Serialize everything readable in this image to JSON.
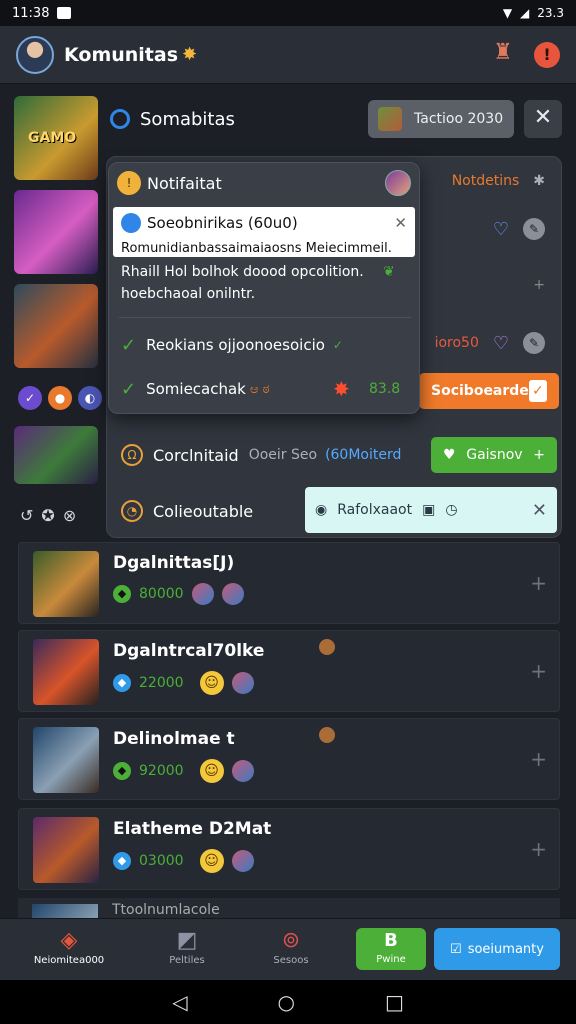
{
  "status_bar": {
    "time": "11:38",
    "right": "23.3"
  },
  "header": {
    "title": "Komunitas",
    "spark": "✸"
  },
  "sidebar": {
    "thumb_label": "GAMO"
  },
  "soma_bar": {
    "label": "Somabitas",
    "pill_text": "Tactioo 2030",
    "close": "✕"
  },
  "back_panel": {
    "row1_text": "Notdetins",
    "row4_text": "ioro50",
    "orange_button": "Sociboearde",
    "row5_name": "Corclnitaid",
    "row5_dim": "Ooeir Seo",
    "row5_blue": "(60Moiterd",
    "green_button": "Gaisnov",
    "row6_name": "Colieoutable",
    "cyan_text": "Rafolxaaot"
  },
  "popup": {
    "title": "Notifaitat",
    "card_title": "Soeobnirikas (60u0)",
    "card_line1": "Romunidianbassaimaiaosns Meiecimmeil.",
    "text_line1": "Rhaill Hol bolhok doood opcolition.",
    "text_line2": "hoebchaoal onilntr.",
    "row1": "Reokians ojjoonoesoicio",
    "row2": "Somiecachak",
    "row2_extra": "ಆ ಠ",
    "row2_num": "83.8"
  },
  "list": {
    "items": [
      {
        "name": "Dgalnittas[J)",
        "value": "80000"
      },
      {
        "name": "Dgalntrcal70lke",
        "value": "22000"
      },
      {
        "name": "Delinolmae t",
        "value": "92000"
      },
      {
        "name": "Elatheme D2Mat",
        "value": "03000"
      }
    ],
    "peek_text": "Ttoolnumlacole"
  },
  "bottom_nav": {
    "items": [
      {
        "label": "Neiomitea000"
      },
      {
        "label": "Peltiles"
      },
      {
        "label": "Sesoos"
      }
    ],
    "green_label": "Pwine",
    "green_glyph": "B",
    "blue_label": "soeiumanty"
  },
  "colors": {
    "accent_orange": "#f07a2a",
    "accent_green": "#4caf38",
    "accent_blue": "#2f9be8",
    "bg": "#1c1f26"
  }
}
